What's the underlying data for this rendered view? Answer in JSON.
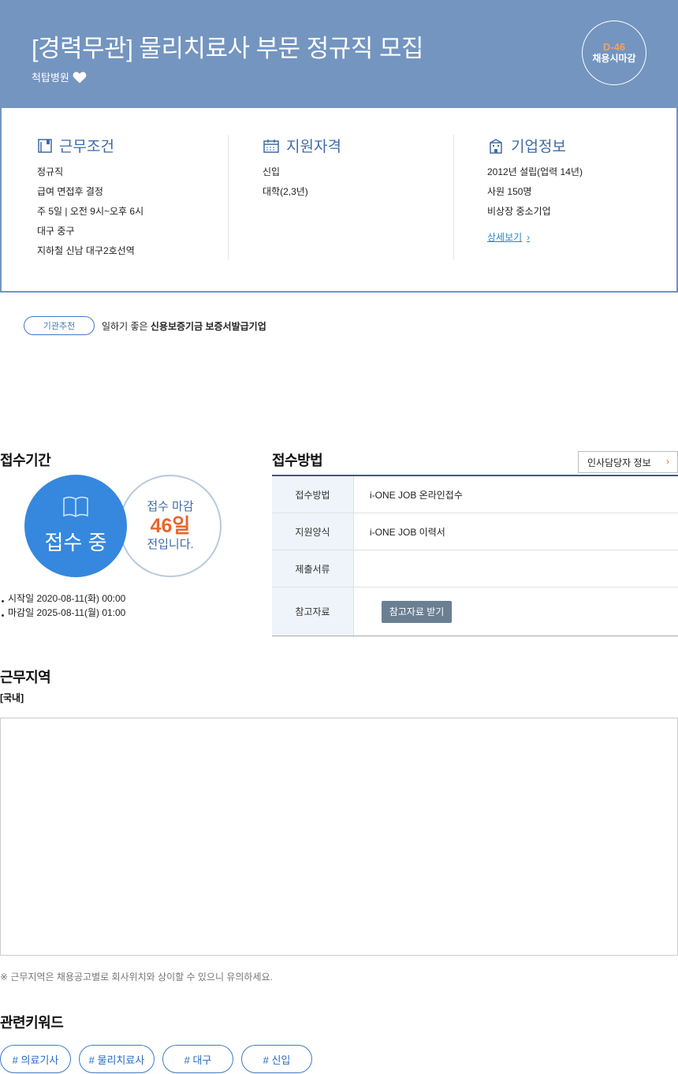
{
  "header": {
    "title": "[경력무관] 물리치료사 부문 정규직 모집",
    "company": "척탑병원",
    "dday": "D-46",
    "dday_label": "채용시마감"
  },
  "info": {
    "work_conditions": {
      "title": "근무조건",
      "lines": [
        "정규직",
        "급여 면접후 결정",
        "주 5일 | 오전 9시~오후 6시",
        "대구 중구",
        "지하철 신남 대구2호선역"
      ]
    },
    "qualifications": {
      "title": "지원자격",
      "lines": [
        "신입",
        "대학(2,3년)"
      ]
    },
    "company_info": {
      "title": "기업정보",
      "lines": [
        "2012년 설립(업력 14년)",
        "사원 150명",
        "비상장 중소기업"
      ],
      "more_label": "상세보기"
    }
  },
  "recommendation": {
    "badge": "기관추천",
    "text_prefix": "일하기 좋은",
    "text_bold": "신용보증기금 보증서발급기업"
  },
  "period": {
    "title": "접수기간",
    "status": "접수 중",
    "deadline_label": "접수 마감",
    "days_left": "46일",
    "deadline_suffix": "전입니다.",
    "start": "시작일 2020-08-11(화) 00:00",
    "end": "마감일 2025-08-11(월) 01:00"
  },
  "apply": {
    "title": "접수방법",
    "hr_button": "인사담당자 정보",
    "rows": [
      {
        "label": "접수방법",
        "value": "i-ONE JOB 온라인접수"
      },
      {
        "label": "지원양식",
        "value": "i-ONE JOB 이력서"
      },
      {
        "label": "제출서류",
        "value": ""
      },
      {
        "label": "참고자료",
        "value": ""
      }
    ],
    "ref_button": "참고자료 받기"
  },
  "region": {
    "title": "근무지역",
    "sub": "[국내]",
    "notice": "※ 근무지역은 채용공고별로 회사위치와 상이할 수 있으니 유의하세요."
  },
  "keywords": {
    "title": "관련키워드",
    "items": [
      "# 의료기사",
      "# 물리치료사",
      "# 대구",
      "# 신입"
    ]
  },
  "colors": {
    "header_bg": "#7395c0",
    "accent_blue": "#3588de",
    "dday": "#f5a15e",
    "days_left": "#e8652b"
  }
}
